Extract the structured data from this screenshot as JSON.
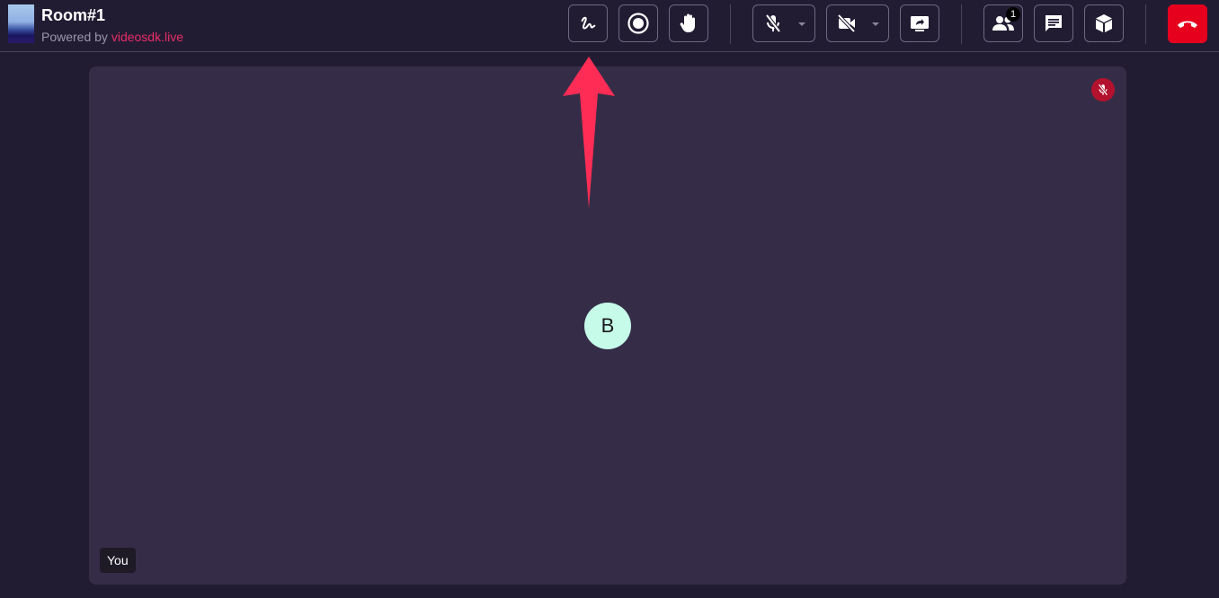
{
  "header": {
    "room_title": "Room#1",
    "powered_prefix": "Powered by",
    "powered_link": "videosdk.live"
  },
  "toolbar": {
    "buttons": [
      {
        "name": "whiteboard",
        "icon": "whiteboard-squiggle-icon"
      },
      {
        "name": "record",
        "icon": "record-icon"
      },
      {
        "name": "raise-hand",
        "icon": "raise-hand-icon"
      },
      {
        "name": "mic",
        "icon": "mic-off-icon",
        "dropdown": true
      },
      {
        "name": "camera",
        "icon": "video-off-icon",
        "dropdown": true
      },
      {
        "name": "screen-share",
        "icon": "screen-share-icon"
      },
      {
        "name": "participants",
        "icon": "people-icon"
      },
      {
        "name": "chat",
        "icon": "chat-icon"
      },
      {
        "name": "more",
        "icon": "cube-icon"
      },
      {
        "name": "leave",
        "icon": "end-call-icon"
      }
    ],
    "participants_count": "1"
  },
  "tile": {
    "avatar_initial": "B",
    "name_label": "You",
    "mic_state": "muted"
  },
  "colors": {
    "background": "#221c33",
    "tile": "#352d47",
    "accent": "#ea2d67",
    "end_call": "#e6001e",
    "avatar": "#c6fbe9",
    "annotation_arrow": "#ff2d55"
  }
}
